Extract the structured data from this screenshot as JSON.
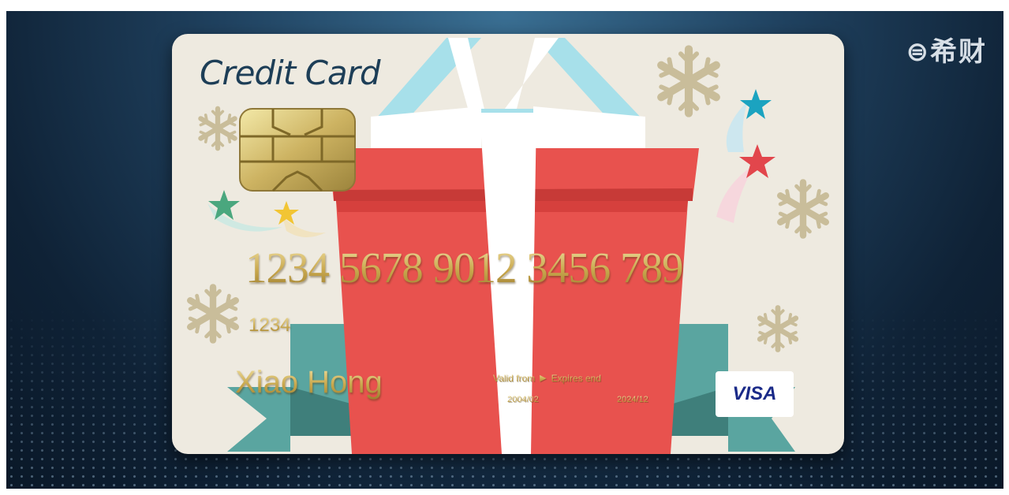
{
  "watermark": "⊜希财",
  "card": {
    "title": "Credit Card",
    "number": "1234 5678 9012 3456 789",
    "small_number": "1234",
    "holder": "Xiao Hong",
    "valid_from_label": "Valid from",
    "expires_label": "Expires end",
    "valid_from_date": "2004/02",
    "expires_date": "2024/12",
    "network": "VISA"
  },
  "colors": {
    "card_bg": "#eeeae0",
    "gift_red": "#e8524e",
    "ribbon_white": "#ffffff",
    "bow_light_blue": "#a7e0ea",
    "banner_teal": "#5aa5a0",
    "gold_text": "#c9ad5e",
    "title_navy": "#1d3e57",
    "visa_blue": "#1a2a88"
  },
  "icons": [
    "emv-chip-icon",
    "snowflake-icon",
    "star-icon",
    "gift-box-illustration",
    "visa-logo"
  ]
}
